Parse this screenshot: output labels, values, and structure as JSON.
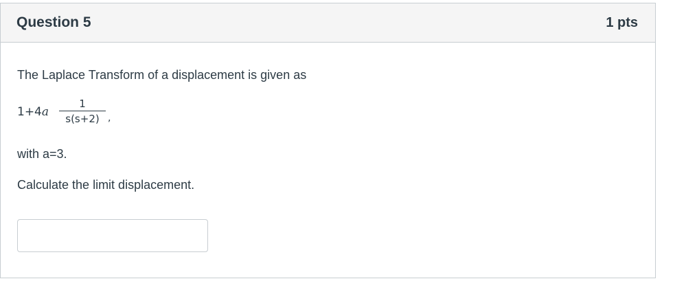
{
  "question": {
    "title": "Question 5",
    "points": "1 pts",
    "intro_text": "The Laplace Transform of a displacement is given as",
    "formula": {
      "prefix": "1+4",
      "prefix_var": "a",
      "numerator": "1",
      "denominator": "s(s+2)",
      "suffix": ","
    },
    "given_text": "with a=3.",
    "prompt_text": "Calculate the limit displacement.",
    "answer": {
      "value": "",
      "placeholder": ""
    }
  }
}
